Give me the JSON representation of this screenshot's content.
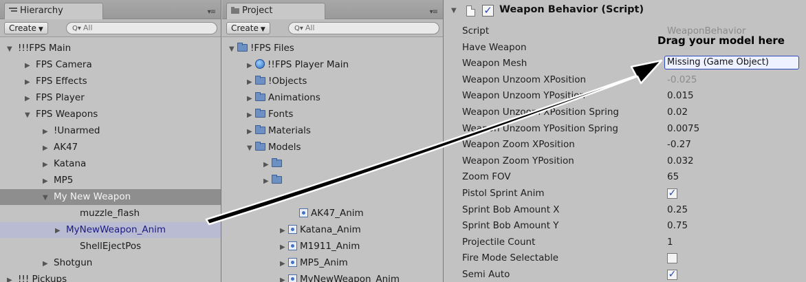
{
  "hierarchy": {
    "tab": "Hierarchy",
    "create": "Create",
    "search_placeholder": "All",
    "items": [
      {
        "label": "!!!FPS Main",
        "tri": "▼"
      },
      {
        "label": "FPS Camera",
        "tri": "▶"
      },
      {
        "label": "FPS Effects",
        "tri": "▶"
      },
      {
        "label": "FPS Player",
        "tri": "▶"
      },
      {
        "label": "FPS Weapons",
        "tri": "▼"
      },
      {
        "label": "!Unarmed",
        "tri": "▶"
      },
      {
        "label": "AK47",
        "tri": "▶"
      },
      {
        "label": "Katana",
        "tri": "▶"
      },
      {
        "label": "MP5",
        "tri": "▶"
      },
      {
        "label": "My New Weapon",
        "tri": "▼"
      },
      {
        "label": "muzzle_flash",
        "tri": ""
      },
      {
        "label": "MyNewWeapon_Anim",
        "tri": "▶"
      },
      {
        "label": "ShellEjectPos",
        "tri": ""
      },
      {
        "label": "Shotgun",
        "tri": "▶"
      },
      {
        "label": "!!! Pickups",
        "tri": "▶"
      }
    ]
  },
  "project": {
    "tab": "Project",
    "create": "Create",
    "search_placeholder": "All",
    "items": [
      {
        "label": "!FPS Files",
        "tri": "▼",
        "icon": "folder"
      },
      {
        "label": "!!FPS Player Main",
        "tri": "▶",
        "icon": "prefab"
      },
      {
        "label": "!Objects",
        "tri": "▶",
        "icon": "folder"
      },
      {
        "label": "Animations",
        "tri": "▶",
        "icon": "folder"
      },
      {
        "label": "Fonts",
        "tri": "▶",
        "icon": "folder"
      },
      {
        "label": "Materials",
        "tri": "▶",
        "icon": "folder"
      },
      {
        "label": "Models",
        "tri": "▼",
        "icon": "folder"
      },
      {
        "label": "",
        "tri": "▶",
        "icon": "folder"
      },
      {
        "label": "",
        "tri": "▶",
        "icon": "folder"
      },
      {
        "label": "",
        "tri": "",
        "icon": ""
      },
      {
        "label": "AK47_Anim",
        "tri": "",
        "icon": "anim"
      },
      {
        "label": "Katana_Anim",
        "tri": "▶",
        "icon": "anim"
      },
      {
        "label": "M1911_Anim",
        "tri": "▶",
        "icon": "anim"
      },
      {
        "label": "MP5_Anim",
        "tri": "▶",
        "icon": "anim"
      },
      {
        "label": "MyNewWeapon_Anim",
        "tri": "▶",
        "icon": "anim"
      }
    ]
  },
  "inspector": {
    "component_title": "Weapon Behavior (Script)",
    "callout": "Drag your model here",
    "properties": [
      {
        "label": "Script",
        "value": "WeaponBehavior",
        "kind": "ghost"
      },
      {
        "label": "Have Weapon",
        "value": "",
        "kind": "text"
      },
      {
        "label": "Weapon Mesh",
        "value": "Missing (Game Object)",
        "kind": "object"
      },
      {
        "label": "Weapon Unzoom XPosition",
        "value": "-0.025",
        "kind": "ghost"
      },
      {
        "label": "Weapon Unzoom YPosition",
        "value": "0.015",
        "kind": "text"
      },
      {
        "label": "Weapon Unzoom XPosition Spring",
        "value": "0.02",
        "kind": "text"
      },
      {
        "label": "Weapon Unzoom YPosition Spring",
        "value": "0.0075",
        "kind": "text"
      },
      {
        "label": "Weapon Zoom XPosition",
        "value": "-0.27",
        "kind": "text"
      },
      {
        "label": "Weapon Zoom YPosition",
        "value": "0.032",
        "kind": "text"
      },
      {
        "label": "Zoom FOV",
        "value": "65",
        "kind": "text"
      },
      {
        "label": "Pistol Sprint Anim",
        "value": "✓",
        "kind": "check"
      },
      {
        "label": "Sprint Bob Amount X",
        "value": "0.25",
        "kind": "text"
      },
      {
        "label": "Sprint Bob Amount Y",
        "value": "0.75",
        "kind": "text"
      },
      {
        "label": "Projectile Count",
        "value": "1",
        "kind": "text"
      },
      {
        "label": "Fire Mode Selectable",
        "value": "",
        "kind": "check"
      },
      {
        "label": "Semi Auto",
        "value": "✓",
        "kind": "check"
      }
    ]
  },
  "colors": {
    "panel": "#c3c3c3",
    "selected_row": "#8e8e8e",
    "hover_row": "#b9bbd3",
    "object_field_border": "#2c47b8",
    "arrow": "#000000"
  }
}
